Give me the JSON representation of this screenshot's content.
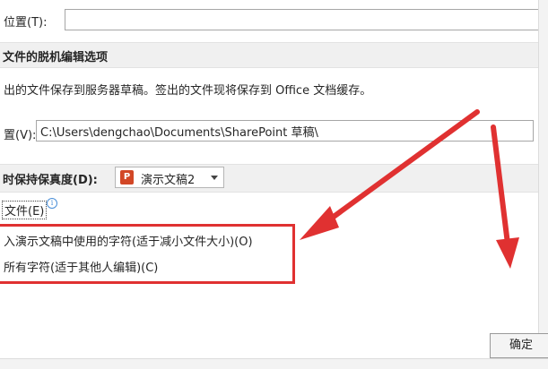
{
  "top": {
    "location_label": "位置(T):"
  },
  "offline": {
    "section_title": "文件的脱机编辑选项",
    "description": "出的文件保存到服务器草稿。签出的文件现将保存到 Office 文档缓存。",
    "path_label": "置(V):",
    "path_value": "C:\\Users\\dengchao\\Documents\\SharePoint 草稿\\"
  },
  "fidelity": {
    "section_title": "时保持保真度(D):",
    "dropdown_value": "演示文稿2",
    "dropdown_icon": "P",
    "file_option_label": "文件(E)",
    "embed_option_label": "入演示文稿中使用的字符(适于减小文件大小)(O)",
    "all_chars_label": "所有字符(适于其他人编辑)(C)"
  },
  "footer": {
    "ok_label": "确定"
  },
  "colors": {
    "annotation_red": "#e03131",
    "section_bg": "#f0f0f0",
    "ppt_orange": "#d24726"
  }
}
